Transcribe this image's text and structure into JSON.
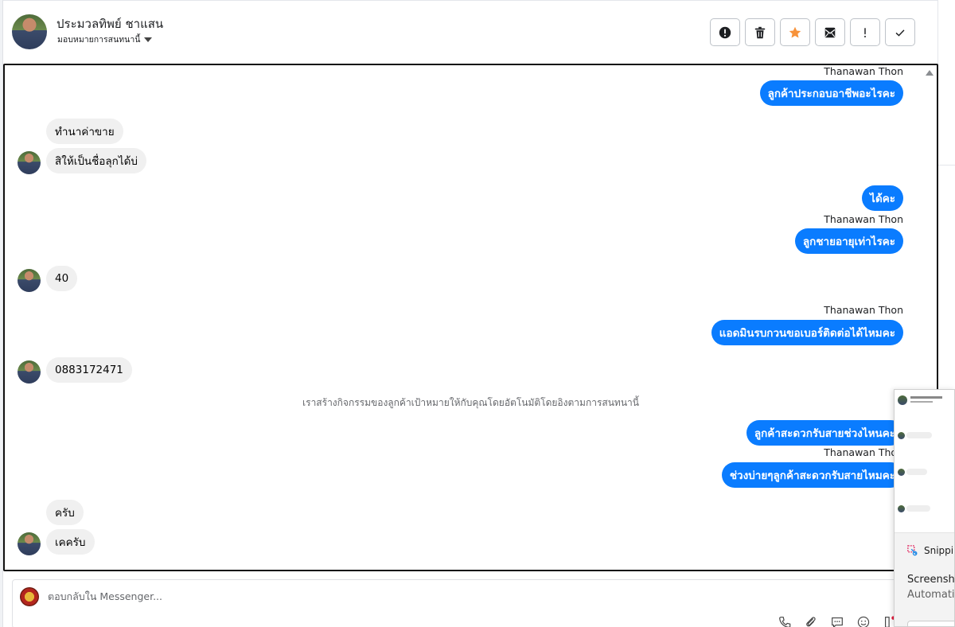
{
  "header": {
    "contact_name": "ประมวลทิพย์ ชาแสน",
    "assign_label": "มอบหมายการสนทนานี้",
    "actions": [
      {
        "name": "report-button",
        "icon": "alert-circle-icon"
      },
      {
        "name": "delete-button",
        "icon": "trash-icon"
      },
      {
        "name": "star-button",
        "icon": "star-icon"
      },
      {
        "name": "mark-unread-button",
        "icon": "envelope-icon"
      },
      {
        "name": "important-button",
        "icon": "exclamation-icon"
      },
      {
        "name": "done-button",
        "icon": "check-icon"
      }
    ]
  },
  "colors": {
    "outgoing_bubble": "#0a7cff",
    "incoming_bubble": "#f0f0f0",
    "star": "#f7923a"
  },
  "messages": {
    "sender_name": "Thanawan Thon",
    "out_1": "ลูกค้าประกอบอาชีพอะไรคะ",
    "in_1": "ทำนาค่าขาย",
    "in_2": "สิให้เป็นชื่อลุกได้บ่",
    "out_2": "ได้คะ",
    "out_3": "ลูกชายอายุเท่าไรคะ",
    "in_3": "40",
    "out_4": "แอดมินรบกวนขอเบอร์ติดต่อได้ไหมคะ",
    "in_4": "0883172471",
    "system_note": "เราสร้างกิจกรรมของลูกค้าเป้าหมายให้กับคุณโดยอัตโนมัติโดยอิงตามการสนทนานี้",
    "out_5": "ลูกค้าสะดวกรับสายช่วงไหนคะ",
    "out_6": "ช่วงบ่ายๆลูกค้าสะดวกรับสายไหมคะ",
    "in_5": "ครับ",
    "in_6": "เคครับ"
  },
  "reply": {
    "placeholder": "ตอบกลับใน Messenger..."
  },
  "snipping": {
    "app_name": "Snippi",
    "line1": "Screensho",
    "line2": "Automatic"
  }
}
